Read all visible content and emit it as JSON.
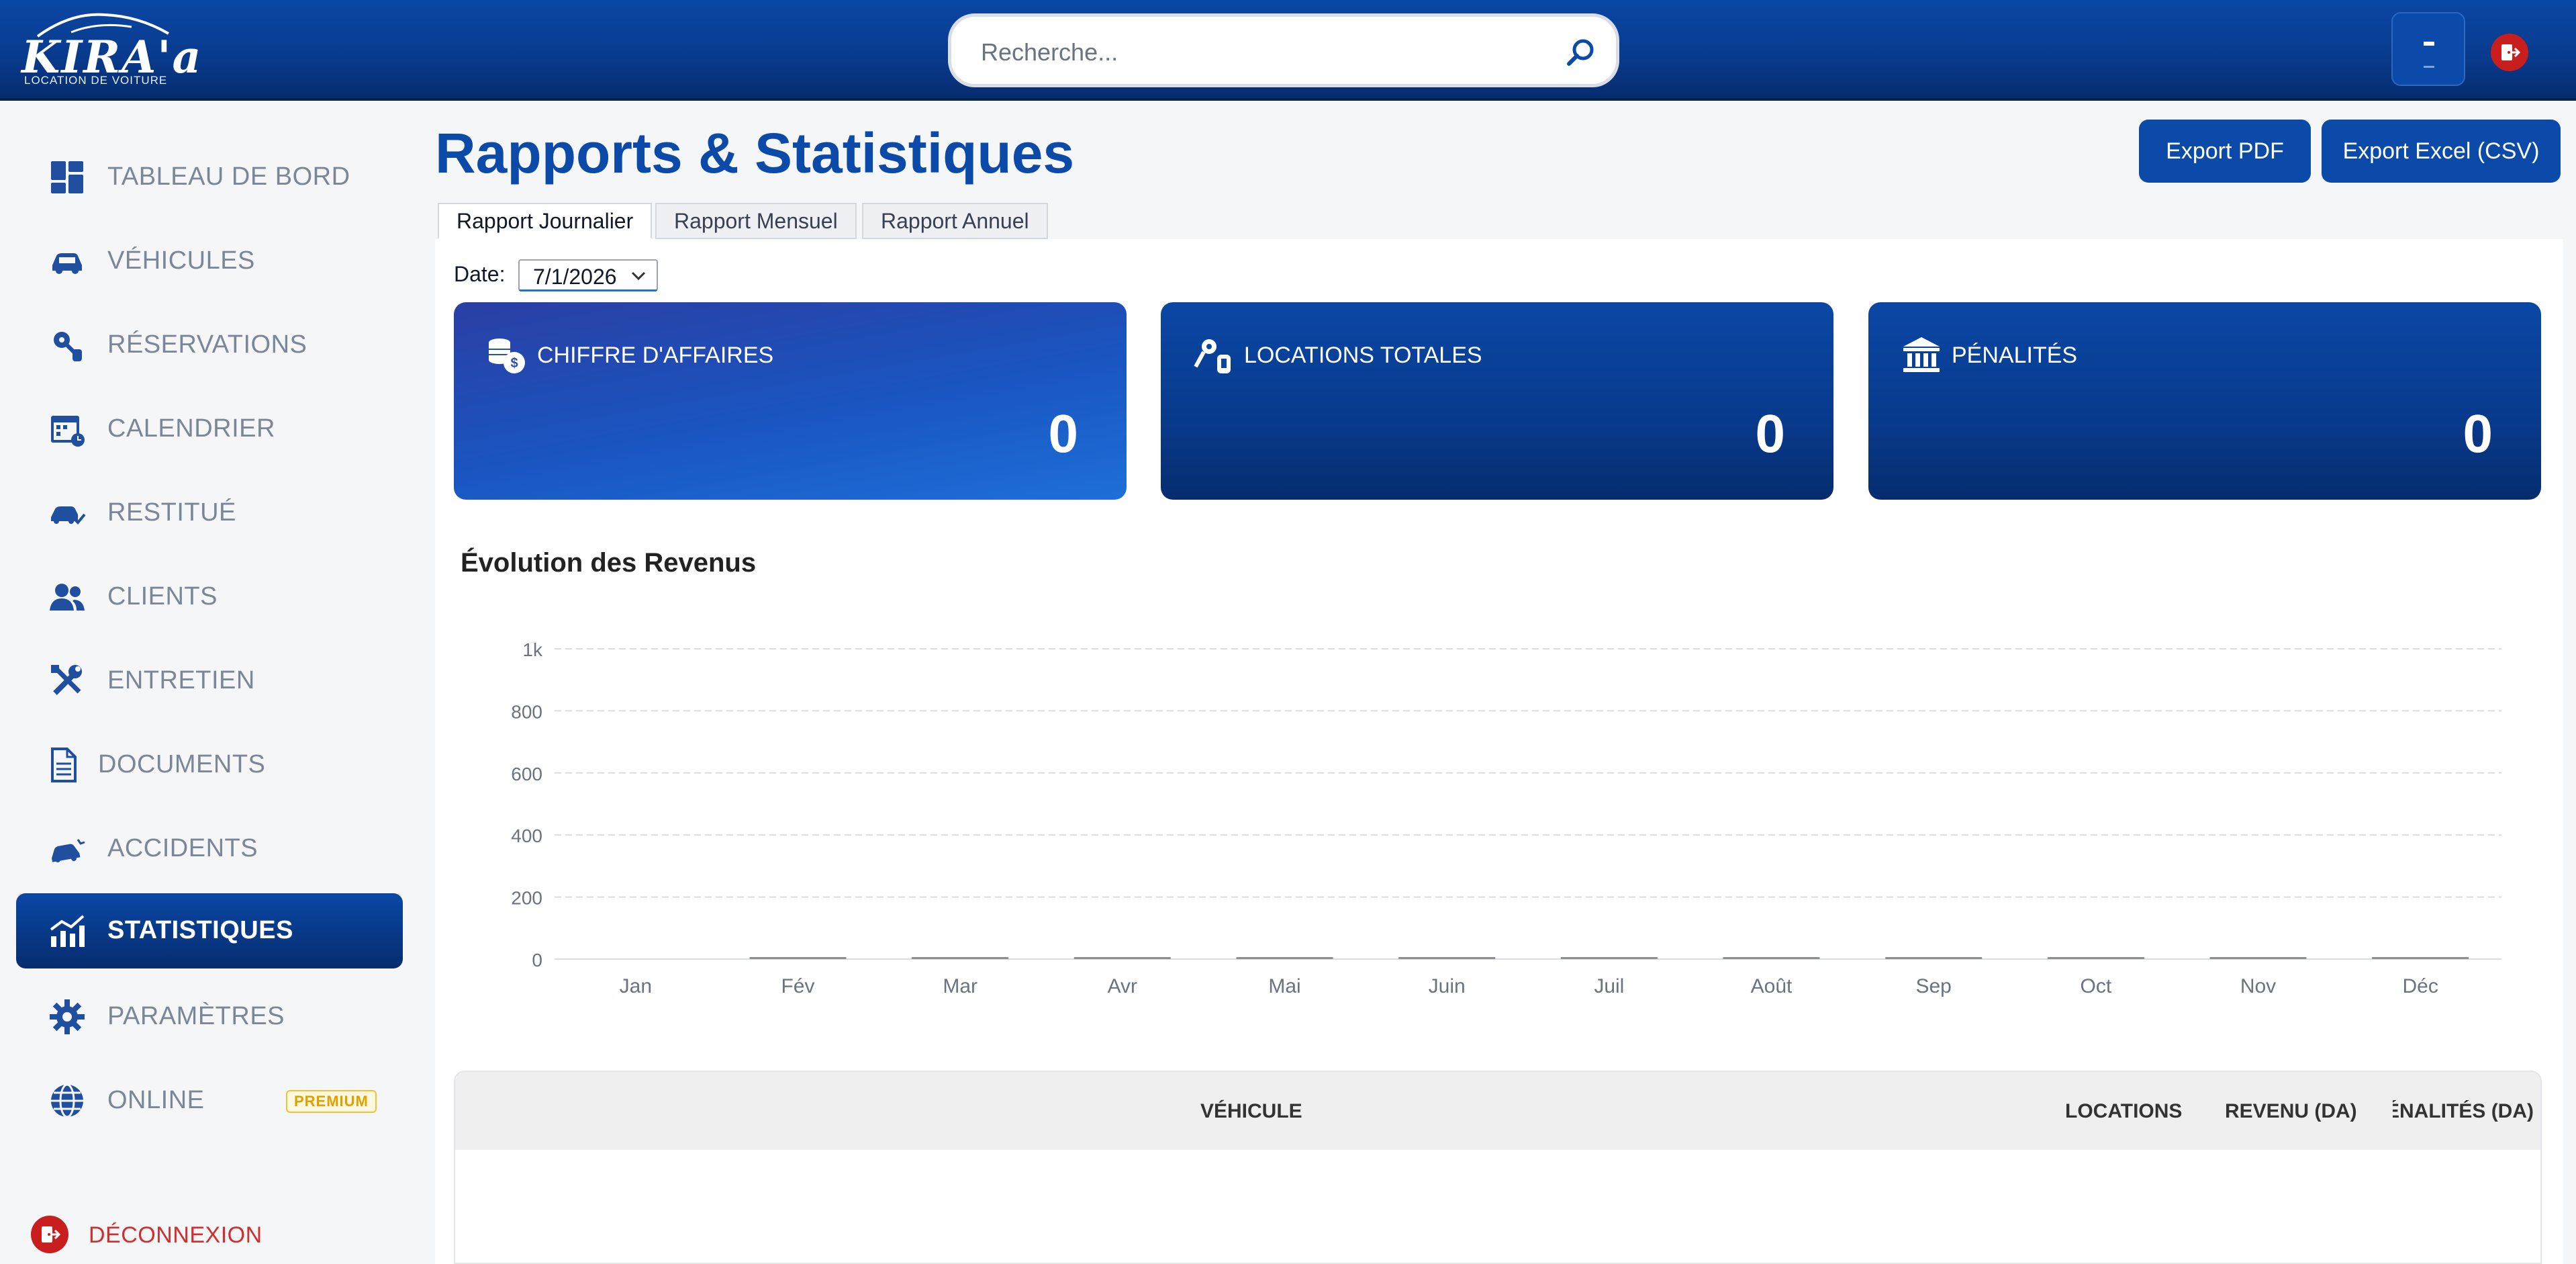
{
  "header": {
    "logo_text": "KIRA'a",
    "logo_subtitle": "LOCATION DE VOITURE",
    "search_placeholder": "Recherche..."
  },
  "sidebar": {
    "items": [
      {
        "label": "TABLEAU DE BORD",
        "icon": "dashboard-icon"
      },
      {
        "label": "VÉHICULES",
        "icon": "car-icon"
      },
      {
        "label": "RÉSERVATIONS",
        "icon": "key-tag-icon"
      },
      {
        "label": "CALENDRIER",
        "icon": "calendar-icon"
      },
      {
        "label": "RESTITUÉ",
        "icon": "car-check-icon"
      },
      {
        "label": "CLIENTS",
        "icon": "users-icon"
      },
      {
        "label": "ENTRETIEN",
        "icon": "tools-icon"
      },
      {
        "label": "DOCUMENTS",
        "icon": "document-icon"
      },
      {
        "label": "ACCIDENTS",
        "icon": "car-crash-icon"
      },
      {
        "label": "STATISTIQUES",
        "icon": "chart-icon",
        "active": true
      },
      {
        "label": "PARAMÈTRES",
        "icon": "gear-icon"
      },
      {
        "label": "ONLINE",
        "icon": "globe-icon",
        "badge": "PREMIUM"
      }
    ],
    "logout_label": "DÉCONNEXION"
  },
  "page": {
    "title": "Rapports & Statistiques",
    "export_pdf": "Export PDF",
    "export_csv": "Export Excel (CSV)",
    "tabs": [
      "Rapport Journalier",
      "Rapport Mensuel",
      "Rapport Annuel"
    ],
    "active_tab": 0,
    "date_label": "Date:",
    "date_value": "7/1/2026"
  },
  "cards": [
    {
      "title": "CHIFFRE D'AFFAIRES",
      "value": "0",
      "icon": "coins-icon"
    },
    {
      "title": "LOCATIONS TOTALES",
      "value": "0",
      "icon": "keys-icon"
    },
    {
      "title": "PÉNALITÉS",
      "value": "0",
      "icon": "bank-icon"
    }
  ],
  "chart_title": "Évolution des Revenus",
  "chart_data": {
    "type": "bar",
    "categories": [
      "Jan",
      "Fév",
      "Mar",
      "Avr",
      "Mai",
      "Juin",
      "Juil",
      "Août",
      "Sep",
      "Oct",
      "Nov",
      "Déc"
    ],
    "values": [
      0,
      0,
      0,
      0,
      0,
      0,
      0,
      0,
      0,
      0,
      0,
      0
    ],
    "yticks": [
      "0",
      "200",
      "400",
      "600",
      "800",
      "1k"
    ],
    "ylim": [
      0,
      1000
    ],
    "grid": true,
    "colors": {
      "bar": "#8a8f98",
      "grid": "#d9dce1",
      "tick": "#6b7280"
    }
  },
  "table": {
    "headers": [
      "VÉHICULE",
      "LOCATIONS",
      "REVENU (DA)",
      "PÉNALITÉS (DA)"
    ],
    "rows": []
  },
  "colors": {
    "primary": "#0b4aa8",
    "danger": "#c81e1e",
    "premium": "#e0a100"
  }
}
